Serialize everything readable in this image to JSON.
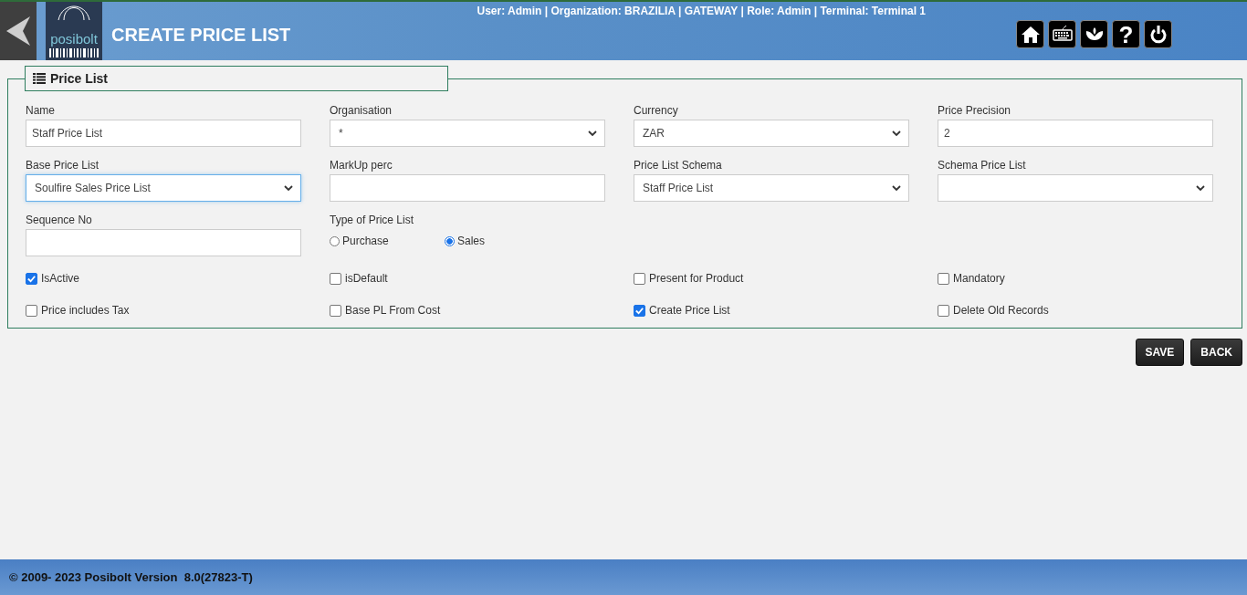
{
  "header": {
    "logo_text": "posibolt",
    "title": "CREATE PRICE LIST",
    "user_info": "User: Admin | Organization: BRAZILIA | GATEWAY | Role: Admin | Terminal: Terminal 1",
    "toolbar": [
      {
        "kind": "home"
      },
      {
        "kind": "keyboard"
      },
      {
        "kind": "flower"
      },
      {
        "kind": "help",
        "text": "?"
      },
      {
        "kind": "power"
      }
    ]
  },
  "section": {
    "title": "Price List",
    "fields": [
      {
        "kind": "text",
        "label": "Name",
        "value": "Staff Price List",
        "focused": false
      },
      {
        "kind": "select",
        "label": "Organisation",
        "value": "*",
        "focused": false
      },
      {
        "kind": "select",
        "label": "Currency",
        "value": "ZAR",
        "focused": false
      },
      {
        "kind": "text",
        "label": "Price Precision",
        "value": "2",
        "focused": false
      },
      {
        "kind": "select",
        "label": "Base Price List",
        "value": "Soulfire Sales Price List",
        "focused": true
      },
      {
        "kind": "text",
        "label": "MarkUp perc",
        "focused": false
      },
      {
        "kind": "select",
        "label": "Price List Schema",
        "value": "Staff Price List",
        "focused": false
      },
      {
        "kind": "select",
        "label": "Schema Price List",
        "focused": false
      },
      {
        "kind": "text",
        "label": "Sequence No",
        "focused": false
      },
      {
        "kind": "radio",
        "label": "Type of Price List",
        "options": [
          {
            "label": "Purchase",
            "selected": false
          },
          {
            "label": "Sales",
            "selected": true
          }
        ]
      }
    ],
    "checkboxes": [
      {
        "label": "IsActive",
        "checked": true
      },
      {
        "label": "isDefault",
        "checked": false
      },
      {
        "label": "Present for Product",
        "checked": false
      },
      {
        "label": "Mandatory",
        "checked": false
      },
      {
        "label": "Price includes Tax",
        "checked": false
      },
      {
        "label": "Base PL From Cost",
        "checked": false
      },
      {
        "label": "Create Price List",
        "checked": true
      },
      {
        "label": "Delete Old Records",
        "checked": false
      }
    ]
  },
  "buttons": [
    "SAVE",
    "BACK"
  ],
  "footer": "© 2009- 2023 Posibolt Version  8.0(27823-T)"
}
